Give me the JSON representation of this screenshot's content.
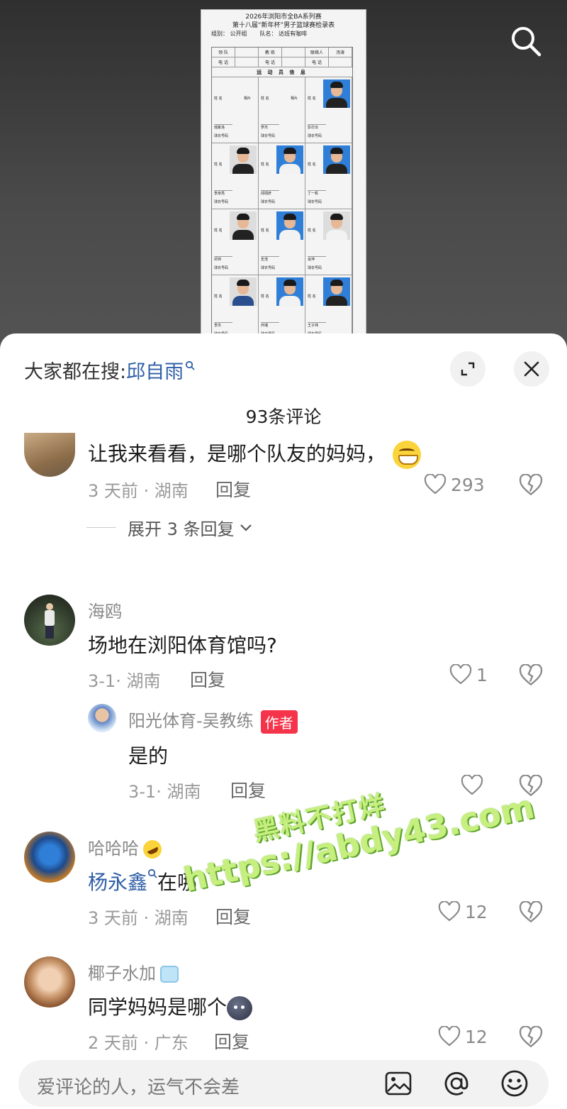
{
  "video": {
    "doc_title_line1": "2026年浏阳市全BA系列赛",
    "doc_title_line2": "第十八届“新年杯”男子篮球赛检录表",
    "doc_group_label": "组别：",
    "doc_group_value": "公开组",
    "doc_team_label": "队名：",
    "doc_team_value": "达班有咖啡",
    "doc_row1": [
      "领 队",
      "",
      "教 练",
      "",
      "联络人",
      "汤涛"
    ],
    "doc_row2": [
      "电 话",
      "",
      "电 话",
      "",
      "电 话",
      ""
    ],
    "doc_section": "运 动 员 信 息",
    "doc_name_label": "姓 名",
    "doc_photo_label": "相片",
    "doc_number_label": "球衣号码",
    "doc_player_names": [
      "瑶紫洛",
      "罗杰",
      "彭打出",
      "李亲亮",
      "邱翊彦",
      "丁一帆",
      "邓帅",
      "史浩",
      "肖萍",
      "李杰",
      "乔瑞",
      "王子玮"
    ]
  },
  "sheet": {
    "hot_search_prefix": "大家都在搜:",
    "hot_search_keyword": "邱自雨",
    "comment_count": "93条评论"
  },
  "comments": [
    {
      "text": "让我来看看，是哪个队友的妈妈，",
      "time": "3 天前 · 湖南",
      "reply": "回复",
      "likes": "293",
      "expand": "展开 3 条回复"
    },
    {
      "user": "海鸥",
      "text": "场地在浏阳体育馆吗?",
      "time": "3-1· 湖南",
      "reply": "回复",
      "likes": "1"
    },
    {
      "user": "阳光体育-吴教练",
      "badge": "作者",
      "text": "是的",
      "time": "3-1· 湖南",
      "reply": "回复",
      "likes": ""
    },
    {
      "user": "哈哈哈",
      "text_link": "杨永鑫",
      "text": "在哪",
      "time": "3 天前 · 湖南",
      "reply": "回复",
      "likes": "12"
    },
    {
      "user": "椰子水加",
      "text": "同学妈妈是哪个",
      "time": "2 天前 · 广东",
      "reply": "回复",
      "likes": "12"
    }
  ],
  "watermark": {
    "line1": "黑料不打烊",
    "line2": "https://abdy43.com"
  },
  "input": {
    "placeholder": "爱评论的人，运气不会差"
  },
  "colors": {
    "link_blue": "#2f5fa7",
    "author_badge": "#f5334a"
  }
}
